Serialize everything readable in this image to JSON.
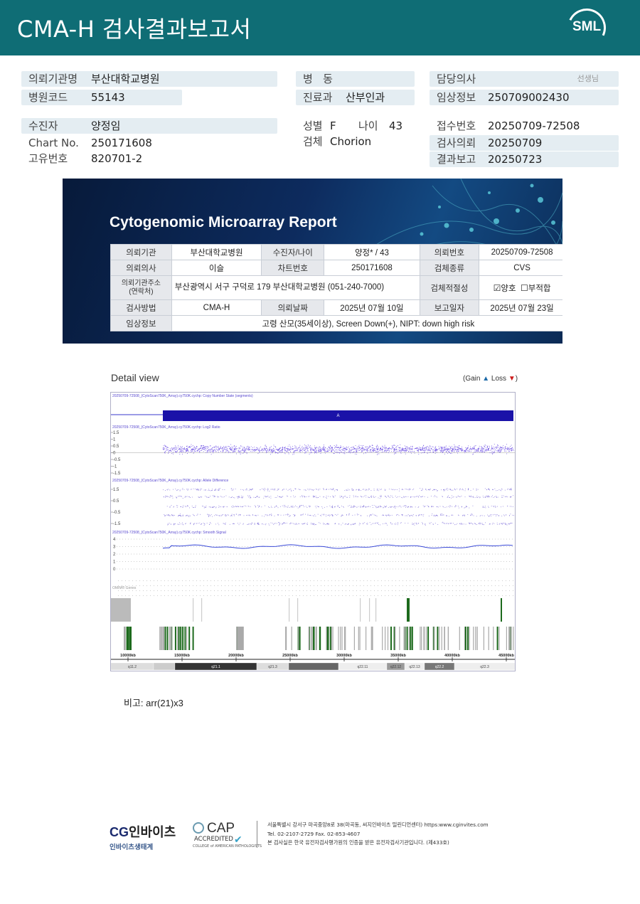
{
  "header": {
    "title": "CMA-H 검사결과보고서",
    "logo": "SML"
  },
  "patient_info": {
    "requesting_institution": {
      "label": "의뢰기관명",
      "value": "부산대학교병원"
    },
    "hospital_code": {
      "label": "병원코드",
      "value": "55143"
    },
    "patient_name": {
      "label": "수진자",
      "value": "양정임"
    },
    "chart_no": {
      "label": "Chart No.",
      "value": "250171608"
    },
    "unique_no": {
      "label": "고유번호",
      "value": "820701-2"
    },
    "ward": {
      "label": "병   동",
      "value": ""
    },
    "department": {
      "label": "진료과",
      "value": "산부인과"
    },
    "sex": {
      "label": "성별",
      "value": "F"
    },
    "age": {
      "label": "나이",
      "value": "43"
    },
    "specimen": {
      "label": "검체",
      "value": "Chorion"
    },
    "doctor": {
      "label": "담당의사",
      "value": "",
      "suffix": "선생님"
    },
    "clinical_info": {
      "label": "임상정보",
      "value": "250709002430"
    },
    "receipt_no": {
      "label": "접수번호",
      "value": "20250709-72508"
    },
    "test_request": {
      "label": "검사의뢰",
      "value": "20250709"
    },
    "result_report": {
      "label": "결과보고",
      "value": "20250723"
    }
  },
  "report": {
    "title": "Cytogenomic Microarray Report",
    "rows": {
      "r1": {
        "h1": "의뢰기관",
        "v1": "부산대학교병원",
        "h2": "수진자/나이",
        "v2": "양정* / 43",
        "h3": "의뢰번호",
        "v3": "20250709-72508"
      },
      "r2": {
        "h1": "의뢰의사",
        "v1": "이슬",
        "h2": "차트번호",
        "v2": "250171608",
        "h3": "검체종류",
        "v3": "CVS"
      },
      "r3": {
        "h1": "의뢰기관주소",
        "h1b": "(연락처)",
        "v1": "부산광역시 서구 구덕로 179 부산대학교병원 (051-240-7000)",
        "h3": "검체적절성",
        "opt1": "양호",
        "opt2": "부적합"
      },
      "r4": {
        "h1": "검사방법",
        "v1": "CMA-H",
        "h2": "의뢰날짜",
        "v2": "2025년 07월 10일",
        "h3": "보고일자",
        "v3": "2025년 07월 23일"
      },
      "r5": {
        "h1": "임상정보",
        "v1": "고령 산모(35세이상), Screen Down(+), NIPT: down high risk"
      }
    }
  },
  "detail_view": {
    "title": "Detail view",
    "legend_prefix": "(Gain",
    "legend_gain_icon": "▲",
    "legend_loss": "Loss",
    "legend_loss_icon": "▼",
    "legend_suffix": ")"
  },
  "chart_data": {
    "type": "scatter",
    "panels": [
      {
        "name": "20250709-72508_(CytoScan750K_Array).cy750K.cychp: Copy Number State (segments)",
        "segment_label": "A"
      },
      {
        "name": "20250709-72508_(CytoScan750K_Array).cy750K.cychp: Log2 Ratio",
        "y_ticks": [
          "1.5",
          "1",
          "0.5",
          "0",
          "-0.5",
          "-1",
          "-1.5"
        ]
      },
      {
        "name": "20250709-72508_(CytoScan750K_Array).cy750K.cychp: Allele Difference",
        "y_ticks": [
          "1.5",
          "0.5",
          "-0.5",
          "-1.5"
        ]
      },
      {
        "name": "20250709-72508_(CytoScan750K_Array).cy750K.cychp: Smooth Signal",
        "y_ticks": [
          "4",
          "3",
          "2",
          "1",
          "0"
        ]
      }
    ],
    "genes_label": "OMIM® Genes",
    "x_ticks": [
      "10000kb",
      "15000kb",
      "20000kb",
      "25000kb",
      "30000kb",
      "35000kb",
      "40000kb",
      "45000kb"
    ],
    "bands": [
      "q11.2",
      "q21.1",
      "q21.3",
      "q22.11",
      "q22.12",
      "q22.13",
      "q22.2",
      "q22.3"
    ],
    "smooth_signal_mean": 3
  },
  "remark": {
    "label": "비고:",
    "value": "arr(21)x3"
  },
  "footer": {
    "logo_cg": "CG",
    "logo_main": "인바이츠",
    "logo_sub": "인바이츠생태계",
    "cap_main": "CAP",
    "cap_accredited": "ACCREDITED",
    "cap_college": "COLLEGE of AMERICAN PATHOLOGISTS",
    "address": "서울특별시 강서구 마곡중앙8로 38(마곡동, 씨지인바이츠 밀린디언센터) https:www.cginvites.com",
    "tel": "Tel. 02-2107-2729   Fax. 02-853-4607",
    "note": "본 검사실은 한국 유전자검사평가원의 인증을 받은 유전자검사기관입니다. (제433호)"
  }
}
